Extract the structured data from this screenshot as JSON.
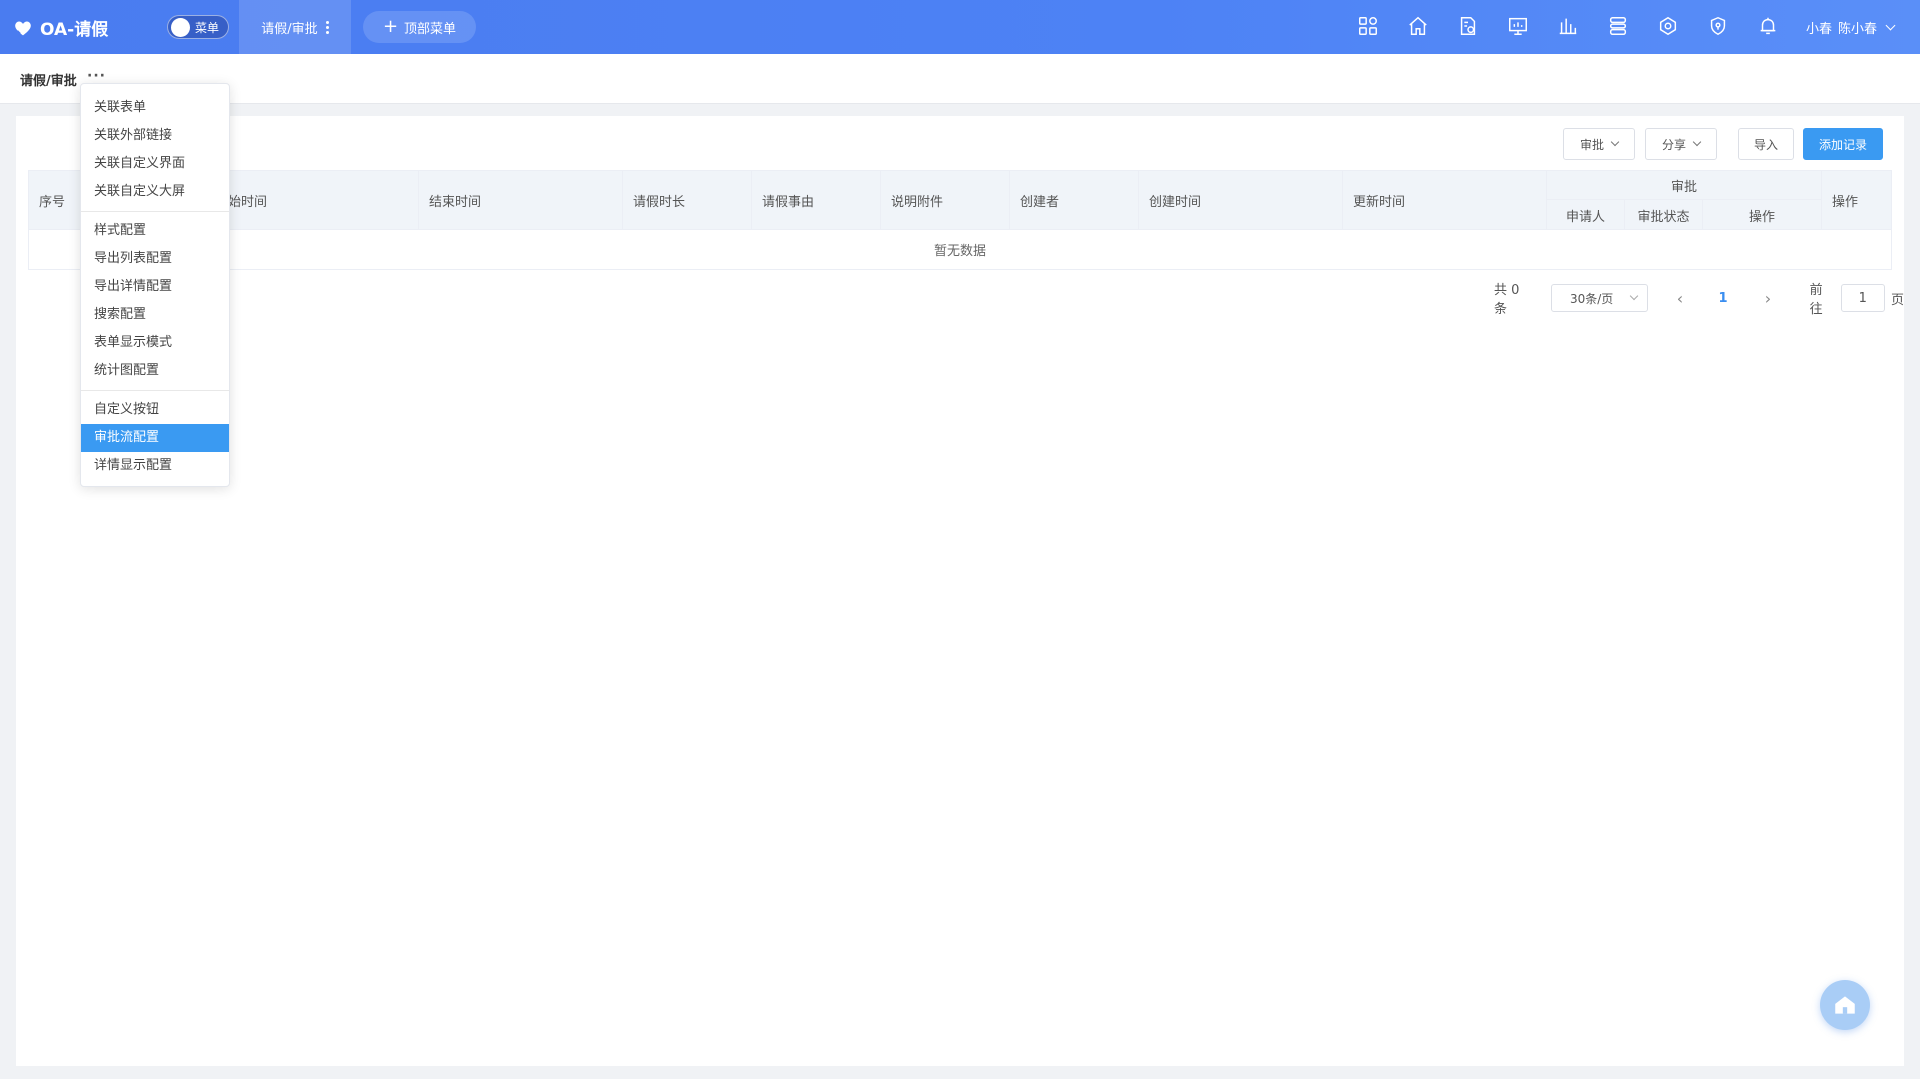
{
  "header": {
    "app_title": "OA-请假",
    "menu_toggle_label": "菜单",
    "active_tab": "请假/审批",
    "top_menu_button": "顶部菜单",
    "icons": [
      "apps-grid-icon",
      "home-icon",
      "form-file-icon",
      "dashboard-icon",
      "chart-icon",
      "flow-icon",
      "integration-icon",
      "security-shield-icon",
      "bell-icon"
    ],
    "user_short": "小春",
    "user_name": "陈小春"
  },
  "breadcrumb": {
    "title": "请假/审批",
    "more": "···"
  },
  "toolbar": {
    "approve": "审批",
    "share": "分享",
    "import": "导入",
    "add_record": "添加记录"
  },
  "table": {
    "columns": [
      "序号",
      "开始时间",
      "结束时间",
      "请假时长",
      "请假事由",
      "说明附件",
      "创建者",
      "创建时间",
      "更新时间"
    ],
    "group_header": "审批",
    "group_columns": [
      "申请人",
      "审批状态",
      "操作"
    ],
    "last_column": "操作",
    "empty_text": "暂无数据"
  },
  "pagination": {
    "total": "共 0 条",
    "page_size": "30条/页",
    "current_page": "1",
    "goto_label": "前往",
    "goto_value": "1",
    "page_suffix": "页"
  },
  "dropdown": {
    "group1": [
      "关联表单",
      "关联外部链接",
      "关联自定义界面",
      "关联自定义大屏"
    ],
    "group2": [
      "样式配置",
      "导出列表配置",
      "导出详情配置",
      "搜索配置",
      "表单显示模式",
      "统计图配置"
    ],
    "group3": [
      "自定义按钮",
      "审批流配置",
      "详情显示配置"
    ],
    "active": "审批流配置"
  },
  "colors": {
    "header": "#4a7cf0",
    "primary": "#3a9af2"
  }
}
